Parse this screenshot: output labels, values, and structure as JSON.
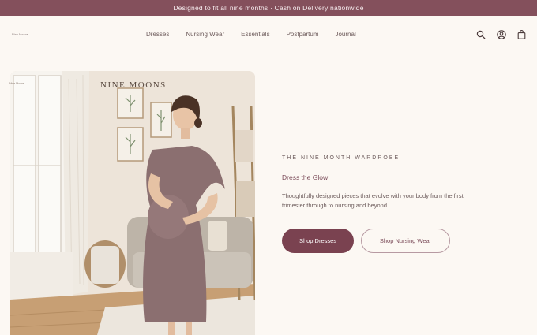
{
  "announcement": "Designed to fit all nine months · Cash on Delivery nationwide",
  "nav": {
    "logo": "Nine Moons",
    "items": [
      "Dresses",
      "Nursing Wear",
      "Essentials",
      "Postpartum",
      "Journal"
    ],
    "icons": [
      "search-icon",
      "account-icon",
      "bag-icon"
    ]
  },
  "hero": {
    "image_brand": "NINE MOONS",
    "image_tag": "Nine Moons",
    "eyebrow": "THE NINE MONTH WARDROBE",
    "subhead": "Dress the Glow",
    "body": "Thoughtfully designed pieces that evolve with your body from the first trimester through to nursing and beyond.",
    "primary_cta": "Shop Dresses",
    "secondary_cta": "Shop Nursing Wear"
  },
  "colors": {
    "brand": "#84505c",
    "primary_button": "#7a4250",
    "background": "#fcf8f3"
  }
}
